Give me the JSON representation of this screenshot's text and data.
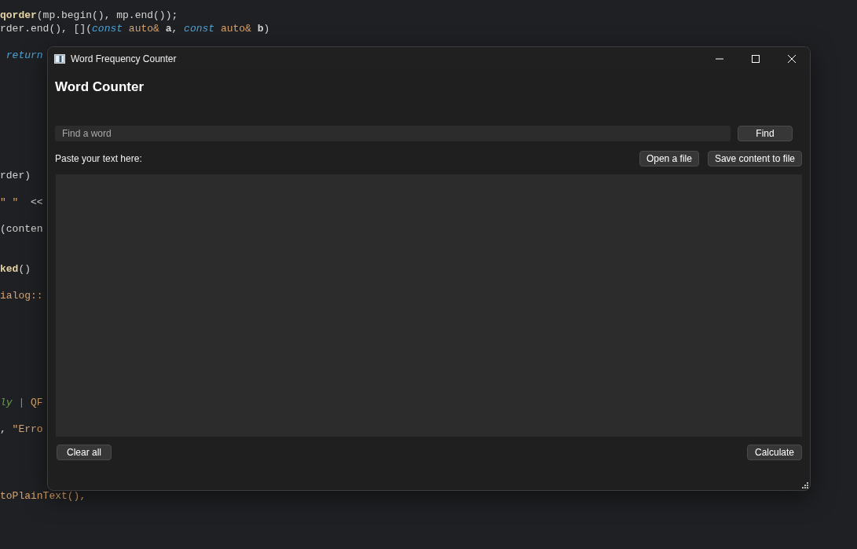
{
  "editor": {
    "code_lines": [
      {
        "segments": [
          {
            "text": "qorder",
            "kind": "function"
          },
          {
            "text": "(mp.begin(), mp.end());",
            "kind": "plain"
          }
        ]
      },
      {
        "segments": [
          {
            "text": "rder.end(), [](",
            "kind": "plain"
          },
          {
            "text": "const",
            "kind": "keyword"
          },
          {
            "text": " auto& ",
            "kind": "type"
          },
          {
            "text": "a",
            "kind": "param"
          },
          {
            "text": ", ",
            "kind": "plain"
          },
          {
            "text": "const",
            "kind": "keyword"
          },
          {
            "text": " auto& ",
            "kind": "type"
          },
          {
            "text": "b",
            "kind": "param"
          },
          {
            "text": ")",
            "kind": "plain"
          }
        ]
      },
      {
        "segments": [
          {
            "text": " return",
            "kind": "keyword"
          }
        ]
      },
      {
        "segments": [
          {
            "text": "rder)",
            "kind": "plain"
          }
        ]
      },
      {
        "segments": [
          {
            "text": "\" \"",
            "kind": "string"
          },
          {
            "text": "  <<",
            "kind": "plain"
          }
        ]
      },
      {
        "segments": [
          {
            "text": "(conten",
            "kind": "plain"
          }
        ]
      },
      {
        "segments": [
          {
            "text": "ked",
            "kind": "function"
          },
          {
            "text": "()",
            "kind": "plain"
          }
        ]
      },
      {
        "segments": [
          {
            "text": "ialog::",
            "kind": "type"
          }
        ]
      },
      {
        "segments": [
          {
            "text": "ly",
            "kind": "comment"
          },
          {
            "text": " | ",
            "kind": "keyword"
          },
          {
            "text": "QF",
            "kind": "type"
          }
        ]
      },
      {
        "segments": [
          {
            "text": ", ",
            "kind": "plain"
          },
          {
            "text": "\"Erro",
            "kind": "type"
          }
        ]
      },
      {
        "segments": [
          {
            "text": "toPlainText(),",
            "kind": "type"
          }
        ]
      }
    ]
  },
  "window": {
    "title": "Word Frequency Counter",
    "heading": "Word Counter",
    "search": {
      "placeholder": "Find a word"
    },
    "find_button": "Find",
    "paste_label": "Paste your text here:",
    "top_buttons": [
      "Open a file",
      "Save content to file"
    ],
    "text_area": {
      "kind": "text"
    },
    "bottom_buttons": [
      "Clear all",
      "Calculate"
    ]
  }
}
